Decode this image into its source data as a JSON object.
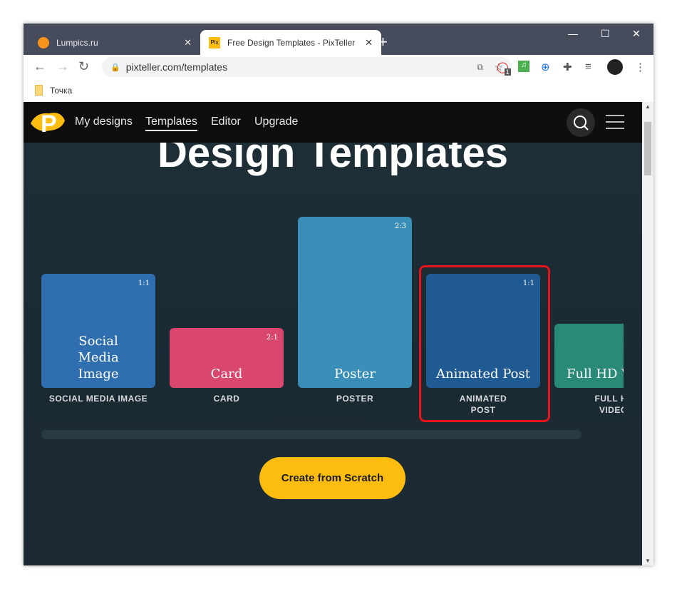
{
  "browser": {
    "tabs": [
      {
        "title": "Lumpics.ru"
      },
      {
        "title": "Free Design Templates - PixTeller"
      }
    ],
    "url": "pixteller.com/templates",
    "bookmark": "Точка",
    "ext_badge": "1"
  },
  "nav": {
    "items": [
      "My designs",
      "Templates",
      "Editor",
      "Upgrade"
    ],
    "active": "Templates"
  },
  "page": {
    "title": "Design Templates",
    "cta": "Create from Scratch"
  },
  "templates": [
    {
      "name": "Social Media Image",
      "label": "SOCIAL MEDIA IMAGE",
      "ratio": "1:1",
      "color": "#2f6fb0"
    },
    {
      "name": "Card",
      "label": "CARD",
      "ratio": "2:1",
      "color": "#d9476f"
    },
    {
      "name": "Poster",
      "label": "POSTER",
      "ratio": "2:3",
      "color": "#3a8fb8"
    },
    {
      "name": "Animated Post",
      "label": "ANIMATED POST",
      "ratio": "1:1",
      "color": "#1f5a93",
      "highlighted": true
    },
    {
      "name": "Full HD V",
      "label": "FULL H VIDEC",
      "ratio": "",
      "color": "#2a8a78"
    }
  ],
  "colors": {
    "accent": "#fcbd10",
    "highlight": "#e8141c"
  }
}
